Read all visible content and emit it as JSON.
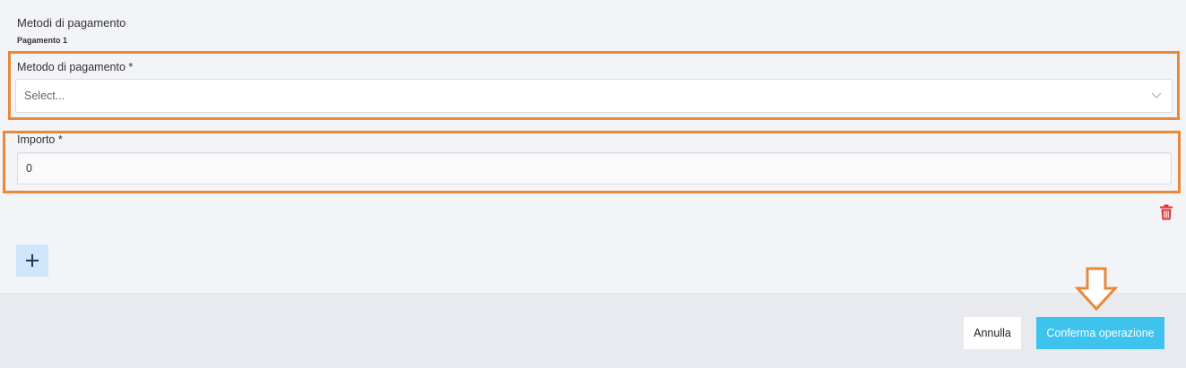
{
  "section": {
    "title": "Metodi di pagamento",
    "payment_label": "Pagamento 1"
  },
  "payment_method": {
    "label": "Metodo di pagamento *",
    "placeholder": "Select..."
  },
  "amount": {
    "label": "Importo *",
    "value": "0"
  },
  "icons": {
    "delete": "trash-icon",
    "add": "plus-icon",
    "dropdown": "chevron-down-icon"
  },
  "footer": {
    "cancel_label": "Annulla",
    "confirm_label": "Conferma operazione"
  },
  "colors": {
    "annotation": "#e8893a",
    "confirm_button": "#3ec3ee",
    "add_button": "#cfe6fb",
    "delete_icon": "#e0363a"
  }
}
